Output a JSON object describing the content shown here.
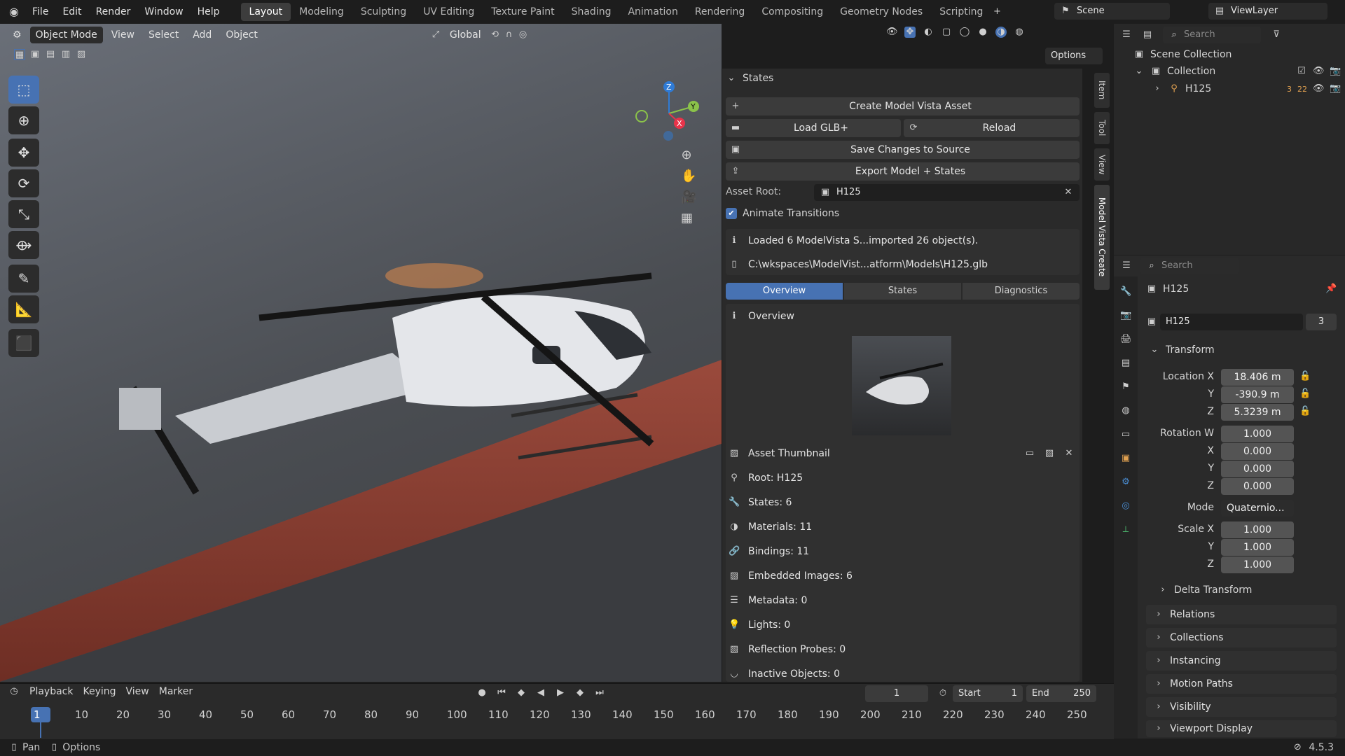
{
  "topbar": {
    "menus": [
      "File",
      "Edit",
      "Render",
      "Window",
      "Help"
    ],
    "workspaces": [
      "Layout",
      "Modeling",
      "Sculpting",
      "UV Editing",
      "Texture Paint",
      "Shading",
      "Animation",
      "Rendering",
      "Compositing",
      "Geometry Nodes",
      "Scripting"
    ],
    "active_workspace": "Layout",
    "scene": "Scene",
    "view_layer": "ViewLayer"
  },
  "viewport_header": {
    "mode": "Object Mode",
    "menus": [
      "View",
      "Select",
      "Add",
      "Object"
    ],
    "transform_orientation": "Global",
    "options": "Options"
  },
  "gizmo": {
    "x": "X",
    "y": "Y",
    "z": "Z"
  },
  "npanel": {
    "panel_title": "States",
    "create_asset": "Create Model Vista Asset",
    "load_glb": "Load GLB+",
    "reload": "Reload",
    "save_changes": "Save Changes to Source",
    "export": "Export Model + States",
    "asset_root_label": "Asset Root:",
    "asset_root_value": "H125",
    "animate_transitions": "Animate Transitions",
    "status_line": "Loaded 6 ModelVista S...imported 26 object(s).",
    "path_line": "C:\\wkspaces\\ModelVist...atform\\Models\\H125.glb",
    "tabs": [
      "Overview",
      "States",
      "Diagnostics"
    ],
    "active_tab": "Overview",
    "overview_heading": "Overview",
    "asset_thumbnail": "Asset Thumbnail",
    "stats": [
      "Root: H125",
      "States: 6",
      "Materials: 11",
      "Bindings: 11",
      "Embedded Images: 6",
      "Metadata: 0",
      "Lights: 0",
      "Reflection Probes: 0",
      "Inactive Objects: 0"
    ]
  },
  "side_tabs": [
    "Item",
    "Tool",
    "View",
    "Model Vista Create"
  ],
  "outliner": {
    "search_placeholder": "Search",
    "scene_collection": "Scene Collection",
    "collection": "Collection",
    "object": "H125",
    "object_badges": [
      "3",
      "22"
    ]
  },
  "properties": {
    "search_placeholder": "Search",
    "object_name": "H125",
    "datablock_name": "H125",
    "users": "3",
    "transform_title": "Transform",
    "location": {
      "label": "Location X",
      "x": "18.406 m",
      "y": "-390.9 m",
      "z": "5.3239 m"
    },
    "rotation": {
      "label": "Rotation W",
      "w": "1.000",
      "x": "0.000",
      "y": "0.000",
      "z": "0.000"
    },
    "mode_label": "Mode",
    "mode_value": "Quaternio...",
    "scale": {
      "label": "Scale X",
      "x": "1.000",
      "y": "1.000",
      "z": "1.000"
    },
    "axis_labels": [
      "Y",
      "Z",
      "X",
      "Y",
      "Z",
      "Y",
      "Z"
    ],
    "sections": [
      "Delta Transform",
      "Relations",
      "Collections",
      "Instancing",
      "Motion Paths",
      "Visibility",
      "Viewport Display"
    ]
  },
  "timeline": {
    "menus": [
      "Playback",
      "Keying",
      "View",
      "Marker"
    ],
    "current_frame": "1",
    "start_label": "Start",
    "start": "1",
    "end_label": "End",
    "end": "250",
    "ticks": [
      "1",
      "10",
      "20",
      "30",
      "40",
      "50",
      "60",
      "70",
      "80",
      "90",
      "100",
      "110",
      "120",
      "130",
      "140",
      "150",
      "160",
      "170",
      "180",
      "190",
      "200",
      "210",
      "220",
      "230",
      "240",
      "250"
    ]
  },
  "statusbar": {
    "pan": "Pan",
    "options": "Options",
    "version": "4.5.3"
  },
  "colors": {
    "accent": "#4772b3",
    "selected_tab": "#4772b3",
    "x_axis": "#e8334a",
    "y_axis": "#8bc34a",
    "z_axis": "#2f7bd6"
  }
}
